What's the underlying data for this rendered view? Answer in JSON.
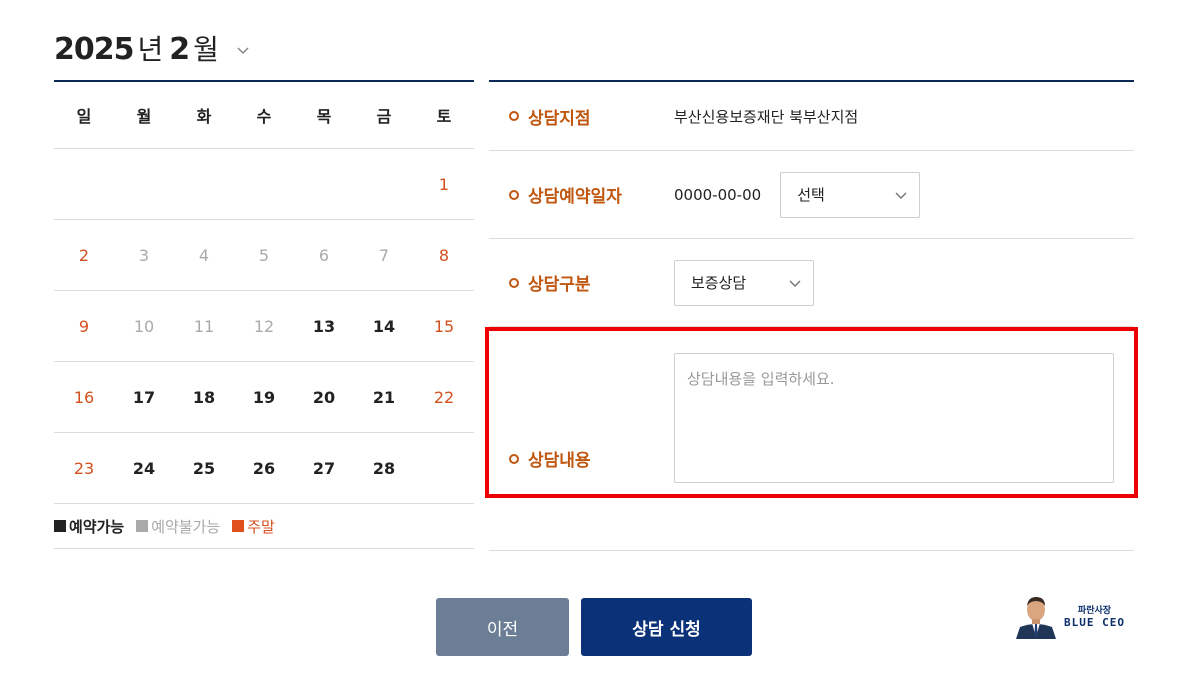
{
  "header": {
    "year": "2025",
    "year_unit": "년",
    "month": "2",
    "month_unit": "월"
  },
  "calendar": {
    "weekdays": [
      "일",
      "월",
      "화",
      "수",
      "목",
      "금",
      "토"
    ],
    "weeks": [
      [
        {
          "d": "",
          "s": ""
        },
        {
          "d": "",
          "s": ""
        },
        {
          "d": "",
          "s": ""
        },
        {
          "d": "",
          "s": ""
        },
        {
          "d": "",
          "s": ""
        },
        {
          "d": "",
          "s": ""
        },
        {
          "d": "1",
          "s": "weekend"
        }
      ],
      [
        {
          "d": "2",
          "s": "weekend"
        },
        {
          "d": "3",
          "s": "unavail"
        },
        {
          "d": "4",
          "s": "unavail"
        },
        {
          "d": "5",
          "s": "unavail"
        },
        {
          "d": "6",
          "s": "unavail"
        },
        {
          "d": "7",
          "s": "unavail"
        },
        {
          "d": "8",
          "s": "weekend"
        }
      ],
      [
        {
          "d": "9",
          "s": "weekend"
        },
        {
          "d": "10",
          "s": "unavail"
        },
        {
          "d": "11",
          "s": "unavail"
        },
        {
          "d": "12",
          "s": "unavail"
        },
        {
          "d": "13",
          "s": "avail"
        },
        {
          "d": "14",
          "s": "avail"
        },
        {
          "d": "15",
          "s": "weekend"
        }
      ],
      [
        {
          "d": "16",
          "s": "weekend"
        },
        {
          "d": "17",
          "s": "avail"
        },
        {
          "d": "18",
          "s": "avail"
        },
        {
          "d": "19",
          "s": "avail"
        },
        {
          "d": "20",
          "s": "avail"
        },
        {
          "d": "21",
          "s": "avail"
        },
        {
          "d": "22",
          "s": "weekend"
        }
      ],
      [
        {
          "d": "23",
          "s": "weekend"
        },
        {
          "d": "24",
          "s": "avail"
        },
        {
          "d": "25",
          "s": "avail"
        },
        {
          "d": "26",
          "s": "avail"
        },
        {
          "d": "27",
          "s": "avail"
        },
        {
          "d": "28",
          "s": "avail"
        },
        {
          "d": "",
          "s": ""
        }
      ]
    ],
    "legend": {
      "available": "예약가능",
      "unavailable": "예약불가능",
      "weekend": "주말"
    }
  },
  "form": {
    "branch": {
      "label": "상담지점",
      "value": "부산신용보증재단 북부산지점"
    },
    "date": {
      "label": "상담예약일자",
      "value": "0000-00-00",
      "time_select": "선택"
    },
    "category": {
      "label": "상담구분",
      "select": "보증상담"
    },
    "content": {
      "label": "상담내용",
      "placeholder": "상담내용을 입력하세요."
    }
  },
  "buttons": {
    "prev": "이전",
    "submit": "상담 신청"
  },
  "logo": {
    "kr": "파란사장",
    "en": "BLUE CEO"
  },
  "colors": {
    "accent_navy": "#0b3278",
    "label_orange": "#c0560f",
    "weekend_red": "#d3501f",
    "unavailable_gray": "#aaaaaa",
    "highlight_red": "#ee0000"
  }
}
